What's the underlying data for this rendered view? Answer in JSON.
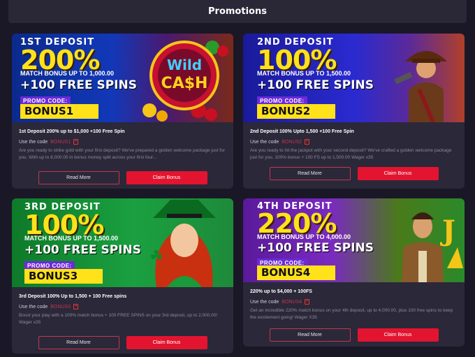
{
  "header": {
    "title": "Promotions"
  },
  "cards": [
    {
      "banner": {
        "title": "1ST DEPOSIT",
        "percent": "200%",
        "match": "MATCH BONUS UP TO 1,000.00",
        "spins": "+100 FREE SPINS",
        "promo_label": "PROMO CODE:",
        "code": "BONUS1",
        "art_text_1": "Wild",
        "art_text_2": "CA$H"
      },
      "title": "1st Deposit 200% up to $1,000 +100 Free Spin",
      "code_prefix": "Use the code",
      "code": "BONUS1",
      "description": "Are you ready to strike gold with your first deposit? We've prepared a golden welcome package just for you. With up to 8,000.00 in bonus money split across your first four...",
      "read_more": "Read More",
      "claim": "Claim Bonus"
    },
    {
      "banner": {
        "title": "2ND DEPOSIT",
        "percent": "100%",
        "match": "MATCH BONUS UP TO 1,500.00",
        "spins": "+100 FREE SPINS",
        "promo_label": "PROMO CODE:",
        "code": "BONUS2"
      },
      "title": "2nd Deposit 100% Upto 1,500 +100 Free Spin",
      "code_prefix": "Use the code",
      "code": "BONUS2",
      "description": "Are you ready to hit the jackpot with your second deposit? We've crafted a golden welcome package just for you. 100% bonus + 100 FS up to 1,500.00 Wager x35",
      "read_more": "Read More",
      "claim": "Claim Bonus"
    },
    {
      "banner": {
        "title": "3RD DEPOSIT",
        "percent": "100%",
        "match": "MATCH BONUS UP TO 1,500.00",
        "spins": "+100 FREE SPINS",
        "promo_label": "PROMO CODE:",
        "code": "BONUS3"
      },
      "title": "3rd Deposit 100% Up to 1,500 + 100 Free spins",
      "code_prefix": "Use the code",
      "code": "BONUS3",
      "description": "Boost your play with a 100% match bonus + 100 FREE SPINS on your 3rd deposit, up to 2,000.00! Wager x35",
      "read_more": "Read More",
      "claim": "Claim Bonus"
    },
    {
      "banner": {
        "title": "4TH DEPOSIT",
        "percent": "220%",
        "match": "MATCH BONUS UP TO 4,000.00",
        "spins": "+100 FREE SPINS",
        "promo_label": "PROMO CODE:",
        "code": "BONUS4"
      },
      "title": "220% up to $4,000 + 100FS",
      "code_prefix": "Use the code",
      "code": "BONUS4",
      "description": "Get an incredible 220% match bonus on your 4th deposit, up to 4,000.00, plus 100 free spins to keep the excitement going! Wager X35",
      "read_more": "Read More",
      "claim": "Claim Bonus"
    }
  ],
  "colors": {
    "accent": "#e3142f",
    "yellow": "#ffe21a",
    "purple": "#6b2bd9",
    "background": "#1a1826",
    "card": "#2b2839"
  }
}
